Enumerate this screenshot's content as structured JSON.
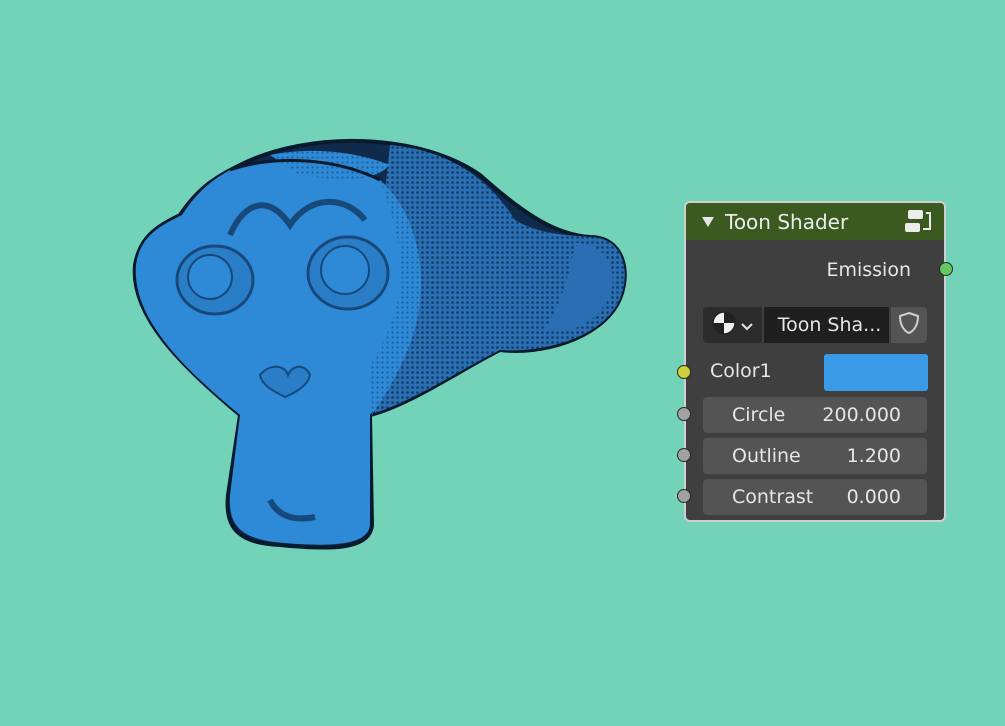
{
  "node": {
    "title": "Toon Shader",
    "output_label": "Emission",
    "datablock": {
      "type_icon": "material-ball-icon",
      "name": "Toon Sha..."
    },
    "inputs": [
      {
        "label": "Color1",
        "color": "#3b9be8"
      },
      {
        "label": "Circle",
        "value": "200.000"
      },
      {
        "label": "Outline",
        "value": "1.200"
      },
      {
        "label": "Contrast",
        "value": "0.000"
      }
    ]
  },
  "colors": {
    "background": "#72d3b8",
    "node_header": "#3b5a1f",
    "node_body": "#3f3f3f",
    "model_blue": "#2e8ad6",
    "socket_shader": "#63c763",
    "socket_color": "#cfd13a",
    "socket_value": "#a2a2a2"
  }
}
